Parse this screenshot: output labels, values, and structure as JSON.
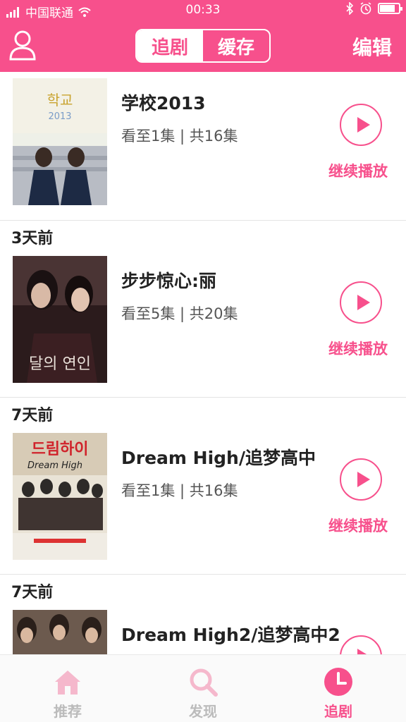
{
  "status_bar": {
    "carrier": "中国联通",
    "time": "00:33",
    "battery_level": 0.8
  },
  "nav": {
    "segments": [
      "追剧",
      "缓存"
    ],
    "active_segment": "追剧",
    "edit_label": "编辑"
  },
  "shows": [
    {
      "time_ago": "",
      "title": "学校2013",
      "progress": "看至1集 | 共16集",
      "action": "继续播放",
      "poster_icon": "school-2013-poster"
    },
    {
      "time_ago": "3天前",
      "title": "步步惊心:丽",
      "progress": "看至5集 | 共20集",
      "action": "继续播放",
      "poster_icon": "moon-lovers-poster"
    },
    {
      "time_ago": "7天前",
      "title": "Dream High/追梦高中",
      "progress": "看至1集 | 共16集",
      "action": "继续播放",
      "poster_icon": "dream-high-poster"
    },
    {
      "time_ago": "7天前",
      "title": "Dream High2/追梦高中2",
      "progress": "",
      "action": "",
      "poster_icon": "dream-high-2-poster"
    }
  ],
  "tabbar": {
    "tabs": [
      {
        "label": "推荐",
        "icon": "home-icon"
      },
      {
        "label": "发现",
        "icon": "search-icon"
      },
      {
        "label": "追剧",
        "icon": "clock-icon"
      }
    ],
    "active_tab": "追剧"
  },
  "colors": {
    "brand": "#f7508c",
    "inactive": "#bbbbbb"
  }
}
